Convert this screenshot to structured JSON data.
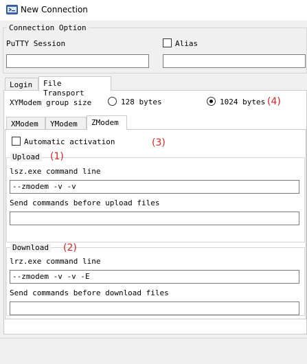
{
  "window": {
    "title": "New Connection"
  },
  "connection_option": {
    "legend": "Connection Option",
    "putty_session_label": "PuTTY Session",
    "putty_session_value": "",
    "alias_label": "Alias",
    "alias_checked": false,
    "alias_value": ""
  },
  "tabs": [
    {
      "label": "Login",
      "active": false
    },
    {
      "label": "File Transport",
      "active": true
    }
  ],
  "xymodem": {
    "group_size_label": "XYModem group size",
    "option_128": "128 bytes",
    "option_1024": "1024 bytes",
    "selected": "1024 bytes"
  },
  "subtabs": [
    {
      "label": "XModem",
      "active": false
    },
    {
      "label": "YModem",
      "active": false
    },
    {
      "label": "ZModem",
      "active": true
    }
  ],
  "zmodem": {
    "automatic_activation_label": "Automatic activation",
    "automatic_activation_checked": false,
    "upload": {
      "legend": "Upload",
      "command_label": "lsz.exe command line",
      "command_value": "--zmodem -v -v",
      "before_label": "Send commands before upload files",
      "before_value": ""
    },
    "download": {
      "legend": "Download",
      "command_label": "lrz.exe command line",
      "command_value": "--zmodem -v -v -E",
      "before_label": "Send commands before download files",
      "before_value": ""
    }
  },
  "annotations": {
    "a1": "(1)",
    "a2": "(2)",
    "a3": "(3)",
    "a4": "(4)",
    "color": "#e02020"
  }
}
